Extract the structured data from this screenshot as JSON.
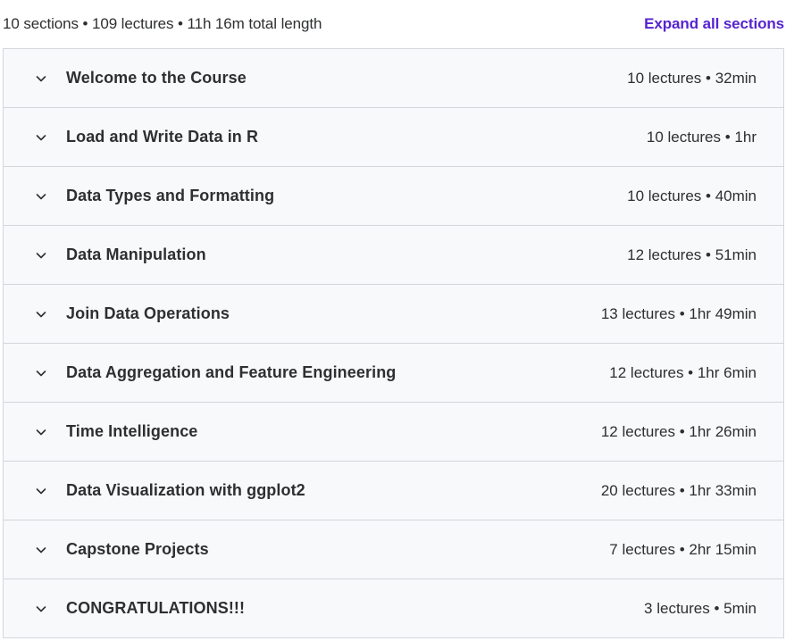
{
  "summary": {
    "text": "10 sections • 109 lectures • 11h 16m total length",
    "expand_all_label": "Expand all sections"
  },
  "sections": [
    {
      "title": "Welcome to the Course",
      "meta": "10 lectures • 32min",
      "icon": "chevron-down-icon"
    },
    {
      "title": "Load and Write Data in R",
      "meta": "10 lectures • 1hr",
      "icon": "chevron-down-icon"
    },
    {
      "title": "Data Types and Formatting",
      "meta": "10 lectures • 40min",
      "icon": "chevron-down-icon"
    },
    {
      "title": "Data Manipulation",
      "meta": "12 lectures • 51min",
      "icon": "chevron-down-icon"
    },
    {
      "title": "Join Data Operations",
      "meta": "13 lectures • 1hr 49min",
      "icon": "chevron-down-icon"
    },
    {
      "title": "Data Aggregation and Feature Engineering",
      "meta": "12 lectures • 1hr 6min",
      "icon": "chevron-down-icon"
    },
    {
      "title": "Time Intelligence",
      "meta": "12 lectures • 1hr 26min",
      "icon": "chevron-down-icon"
    },
    {
      "title": "Data Visualization with ggplot2",
      "meta": "20 lectures • 1hr 33min",
      "icon": "chevron-down-icon"
    },
    {
      "title": "Capstone Projects",
      "meta": "7 lectures • 2hr 15min",
      "icon": "chevron-down-icon"
    },
    {
      "title": "CONGRATULATIONS!!!",
      "meta": "3 lectures • 5min",
      "icon": "chevron-down-icon"
    }
  ],
  "colors": {
    "accent": "#5624d0",
    "row_background": "#f7f9fa",
    "border": "#d1d7dc",
    "text": "#2d2f31"
  }
}
